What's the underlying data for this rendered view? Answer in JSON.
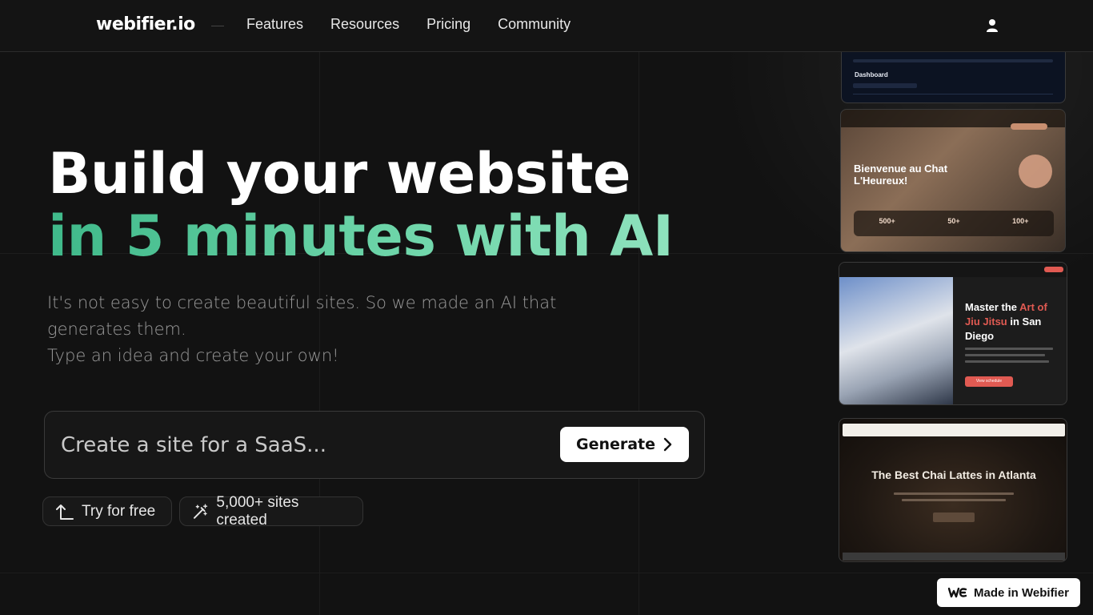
{
  "header": {
    "logo": "webifier.io",
    "nav": [
      {
        "label": "Features"
      },
      {
        "label": "Resources"
      },
      {
        "label": "Pricing"
      },
      {
        "label": "Community"
      }
    ],
    "user_icon": "user-icon"
  },
  "hero": {
    "title_line1": "Build your website",
    "title_line2": "in 5 minutes with AI",
    "subtitle_line1": "It's not easy to create beautiful sites. So we made an AI that generates them.",
    "subtitle_line2": "Type an idea and create your own!",
    "accent_gradient": [
      "#3fb98a",
      "#9ae6c4"
    ]
  },
  "prompt": {
    "placeholder": "Create a site for a SaaS...",
    "generate_label": "Generate"
  },
  "chips": {
    "try_label": "Try for free",
    "sites_label": "5,000+ sites created"
  },
  "previews": {
    "dashboard": {
      "title": "Dashboard"
    },
    "chat": {
      "title": "Bienvenue au Chat L'Heureux!",
      "stats": [
        "500+",
        "50+",
        "100+"
      ]
    },
    "jiujitsu": {
      "title_pre": "Master the ",
      "title_accent": "Art of Jiu Jitsu",
      "title_post": " in San Diego",
      "cta": "View schedule"
    },
    "chai": {
      "title": "The Best Chai Lattes in Atlanta"
    }
  },
  "badge": {
    "label": "Made in Webifier"
  },
  "colors": {
    "background": "#121212",
    "accent": "#3fb98a",
    "jiujitsu_accent": "#e05a52"
  }
}
